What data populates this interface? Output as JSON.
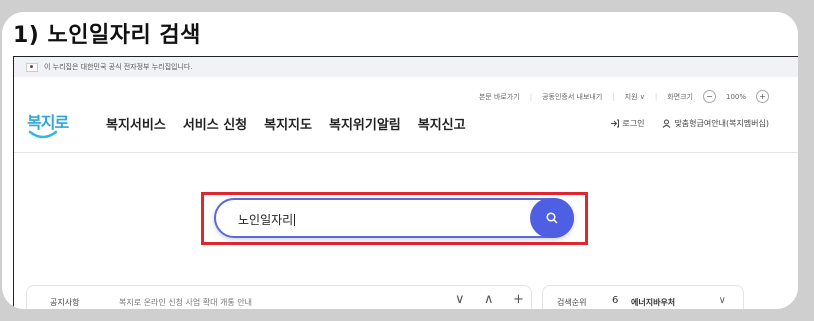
{
  "step": {
    "title": "1) 노인일자리 검색"
  },
  "banner": {
    "text": "이 누리집은 대한민국 공식 전자정부 누리집입니다."
  },
  "utility": {
    "skip": "본문 바로가기",
    "cert": "공동인증서 내보내기",
    "lang": "지원 ∨",
    "zoom_label": "화면크기",
    "zoom_minus": "−",
    "zoom_value": "100%",
    "zoom_plus": "+"
  },
  "logo": {
    "text": "복지로"
  },
  "nav": [
    "복지서비스",
    "서비스 신청",
    "복지지도",
    "복지위기알림",
    "복지신고"
  ],
  "user": {
    "login": "로그인",
    "custom": "맞춤형급여안내(복지멤버십)"
  },
  "search": {
    "value": "노인일자리"
  },
  "notice": {
    "label": "공지사항",
    "text": "복지로 온라인 신청 사업 확대 개통 안내",
    "down": "∨",
    "up": "∧",
    "add": "+"
  },
  "ranking": {
    "label": "검색순위",
    "number": "6",
    "text": "에너지바우처",
    "chevron": "∨"
  },
  "colors": {
    "accent": "#4f5fe3",
    "highlight": "#e0262f",
    "logo": "#2fa7d6"
  }
}
